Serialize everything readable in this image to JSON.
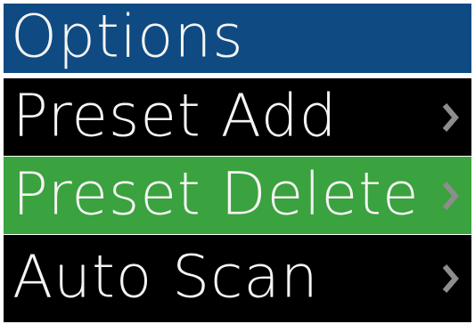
{
  "menu": {
    "title": "Options",
    "items": [
      {
        "label": "Preset Add",
        "icon": "chevron-right-icon",
        "selected": false
      },
      {
        "label": "Preset Delete",
        "icon": "chevron-right-icon",
        "selected": true
      },
      {
        "label": "Auto Scan",
        "icon": "chevron-right-icon",
        "selected": false
      }
    ]
  },
  "colors": {
    "title_bg": "#0f4b82",
    "item_bg": "#000000",
    "selected_bg": "#3aa23e",
    "text": "#f4f4f4",
    "chevron": "#8d8d8d"
  }
}
